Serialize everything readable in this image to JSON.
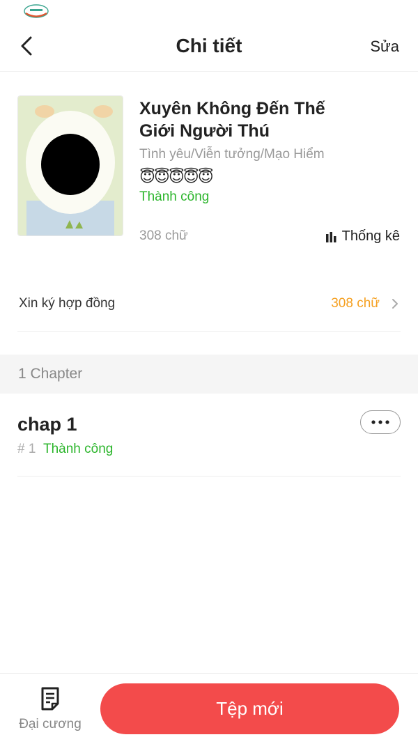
{
  "nav": {
    "title": "Chi tiết",
    "edit_label": "Sửa"
  },
  "book": {
    "title": "Xuyên Không Đến Thế Giới Người Thú",
    "genres": "Tình yêu/Viễn tưởng/Mạo Hiểm",
    "emojis": "😇😇😇😇😇",
    "status": "Thành công",
    "word_count": "308 chữ",
    "stats_label": "Thống kê"
  },
  "contract": {
    "label": "Xin ký hợp đồng",
    "value": "308 chữ"
  },
  "chapters": {
    "count_label": "1 Chapter",
    "items": [
      {
        "title": "chap 1",
        "number": "# 1",
        "status": "Thành công"
      }
    ]
  },
  "bottom": {
    "outline_label": "Đại cương",
    "new_file_label": "Tệp mới"
  },
  "colors": {
    "accent": "#f34b4b",
    "success": "#2bb52b",
    "highlight": "#f5a021"
  },
  "icons": [
    "carrier-logo",
    "back-arrow-icon",
    "bar-chart-icon",
    "chevron-right-icon",
    "more-dots-icon",
    "outline-document-icon"
  ]
}
